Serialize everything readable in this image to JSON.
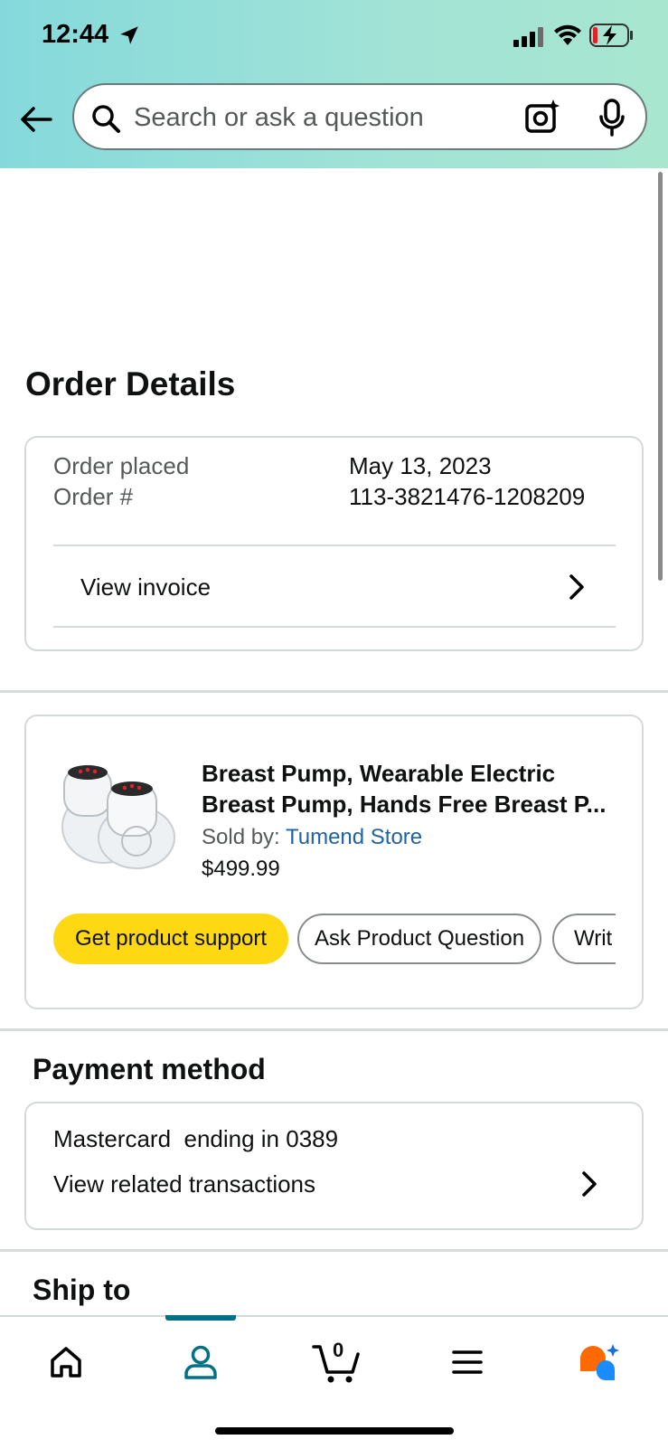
{
  "status_bar": {
    "time": "12:44"
  },
  "search": {
    "placeholder": "Search or ask a question"
  },
  "page": {
    "title": "Order Details"
  },
  "order": {
    "placed_label": "Order placed",
    "placed_value": "May 13, 2023",
    "number_label": "Order #",
    "number_value": "113-3821476-1208209",
    "invoice_label": "View invoice"
  },
  "product": {
    "title_line1": "Breast Pump, Wearable Electric",
    "title_line2": "Breast Pump, Hands Free Breast P...",
    "sold_by_label": "Sold by:",
    "seller": "Tumend Store",
    "price": "$499.99",
    "buttons": [
      "Get product support",
      "Ask Product Question",
      "Writ"
    ]
  },
  "payment": {
    "title": "Payment method",
    "card_text": "Mastercard  ending in 0389",
    "transactions_label": "View related transactions"
  },
  "ship_to": {
    "title": "Ship to"
  },
  "bottom_nav": {
    "items": [
      "home-icon",
      "account-icon",
      "cart-icon",
      "menu-icon",
      "rufus-icon"
    ],
    "cart_count": "0",
    "active": "account"
  },
  "colors": {
    "accent": "#007185",
    "primary_button": "#FFD814",
    "link": "#2162A1",
    "header_gradient_start": "#85D9DC",
    "header_gradient_end": "#A8E6CF"
  }
}
